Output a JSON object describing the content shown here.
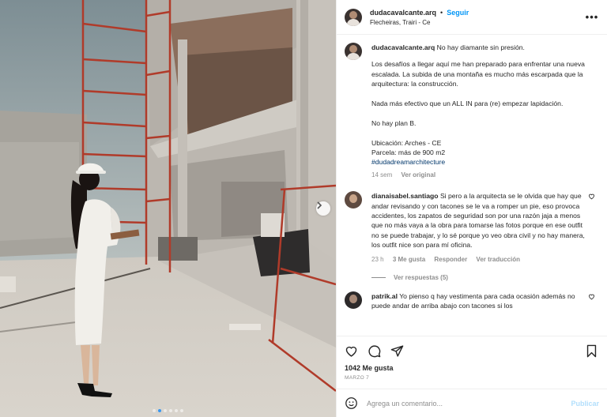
{
  "post": {
    "username": "dudacavalcante.arq",
    "separator": "•",
    "follow_label": "Seguir",
    "location": "Flecheiras, Trairi - Ce",
    "photo_description": "Woman in white dress and hard hat at construction site",
    "carousel": {
      "count": 6,
      "active": 1
    }
  },
  "caption": {
    "username": "dudacavalcante.arq",
    "title": "No hay diamante sin presión.",
    "paragraph1": "Los desafíos a llegar aquí me han preparado para enfrentar una nueva escalada. La subida de una montaña es mucho más escarpada que la arquitectura: la construcción.",
    "paragraph2": "Nada más efectivo que un ALL IN para (re) empezar lapidación.",
    "paragraph3": "No hay plan B.",
    "location_line": "Ubicación: Arches - CE",
    "plot_line": "Parcela: más de 900 m2",
    "hashtag": "#dudadreamarchitecture",
    "time": "14 sem",
    "translate": "Ver original"
  },
  "comments": [
    {
      "username": "dianaisabel.santiago",
      "text": "Si pero a la arquitecta se le olvida que hay que andar revisando y con tacones se le va a romper un pie, eso provoca accidentes, los zapatos de seguridad son por una razón jaja a menos que no más vaya a la obra para tomarse las fotos porque en ese outfit no se puede trabajar, y lo sé porque yo veo obra civil y no hay manera, los outfit nice son para mí oficina.",
      "time": "23 h",
      "likes": "3 Me gusta",
      "reply": "Responder",
      "translate": "Ver traducción",
      "view_replies": "Ver respuestas (5)"
    },
    {
      "username": "patrik.al",
      "text": "Yo pienso q hay vestimenta para cada ocasión además no puede andar de arriba abajo con tacones si los"
    }
  ],
  "footer": {
    "likes": "1042 Me gusta",
    "date": "MARZO 7",
    "comment_placeholder": "Agrega un comentario...",
    "publish_label": "Publicar"
  },
  "colors": {
    "accent": "#0095f6",
    "hashtag": "#00376b",
    "muted": "#8e8e8e",
    "publish_disabled": "#b2dffc"
  },
  "icons": [
    "more-options-icon",
    "next-arrow-icon",
    "heart-icon",
    "comment-icon",
    "share-icon",
    "bookmark-icon",
    "emoji-icon"
  ]
}
